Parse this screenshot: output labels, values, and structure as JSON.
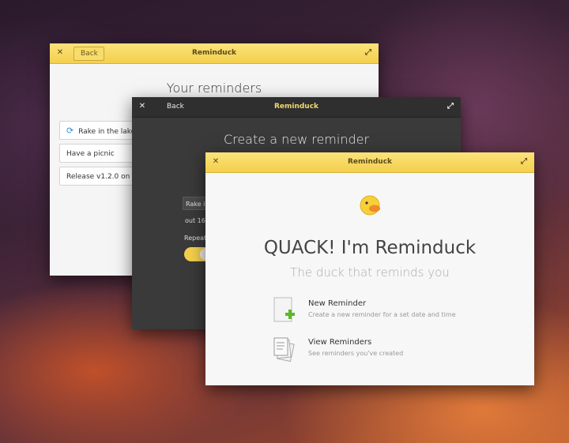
{
  "window1": {
    "title": "Reminduck",
    "back_label": "Back",
    "heading": "Your reminders",
    "reminders": [
      {
        "label": "Rake in the lake"
      },
      {
        "label": "Have a picnic"
      },
      {
        "label": "Release v1.2.0 on Ap"
      }
    ]
  },
  "window2": {
    "title": "Reminduck",
    "back_label": "Back",
    "heading": "Create a new reminder",
    "description_value": "Rake i",
    "time_value": "out 16",
    "repeat_label": "Repeat"
  },
  "window3": {
    "title": "Reminduck",
    "hero_title": "QUACK! I'm Reminduck",
    "subtitle": "The duck that reminds you",
    "new_reminder": {
      "title": "New Reminder",
      "description": "Create a new reminder for a set date and time"
    },
    "view_reminders": {
      "title": "View Reminders",
      "description": "See reminders you've created"
    }
  },
  "colors": {
    "accent_yellow": "#f3cf4c",
    "dark_window": "#3a3a3a",
    "add_green": "#5cb82a"
  }
}
